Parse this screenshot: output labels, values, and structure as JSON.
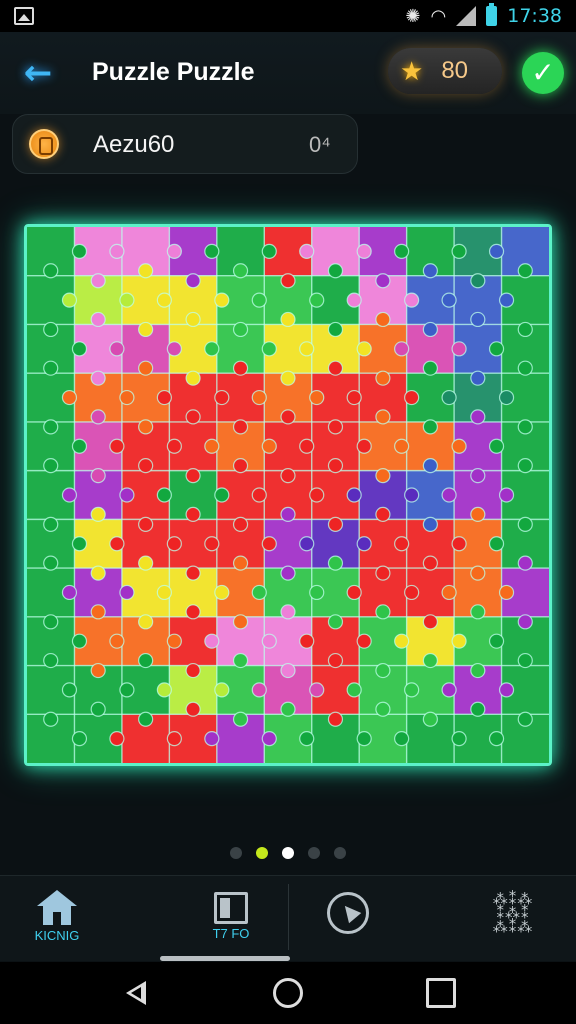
{
  "status_bar": {
    "time": "17:38"
  },
  "header": {
    "title": "Puzzle Puzzle",
    "coins": "80"
  },
  "info": {
    "name": "Aezu60",
    "count": "0⁴"
  },
  "board": {
    "rows": 11,
    "cols": 11,
    "palette": {
      "g": "#12a83f",
      "G": "#2fc44a",
      "r": "#ee2424",
      "o": "#f76a1c",
      "y": "#f2e324",
      "p": "#a230c8",
      "k": "#ee7fd8",
      "b": "#3c5ec8",
      "L": "#b6ec3a",
      "n": "#d84ab2",
      "d": "#5a2cbe",
      "t": "#1a8c64"
    },
    "pattern": [
      "gkkpgrkpgtb",
      "gLyyGGgkbbg",
      "gknyGyyonbg",
      "goorrorrgtg",
      "gnrrorroopg",
      "gprgrrrdbpg",
      "gyrrrpdrrog",
      "gpyyoGGrrop",
      "goorkkrGyGg",
      "gggLGnrGGpg",
      "ggrrpGgGggg"
    ]
  },
  "pager": {
    "count": 5,
    "lime_index": 1,
    "active_index": 2
  },
  "bottom_nav": {
    "home_label": "KICNIG",
    "gallery_label": "T7 FO"
  }
}
